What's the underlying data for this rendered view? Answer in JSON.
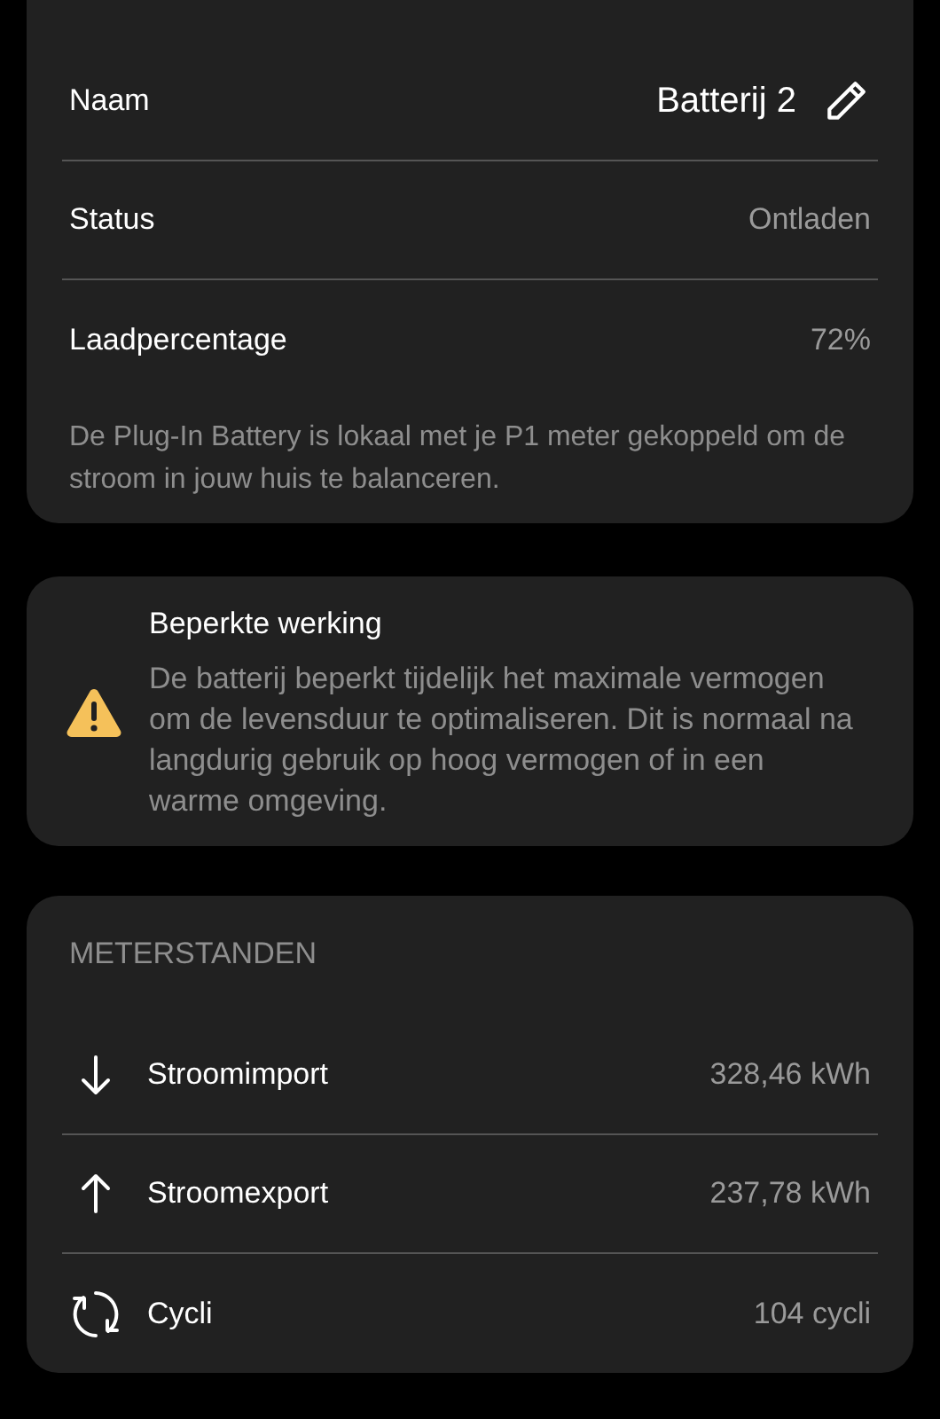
{
  "details": {
    "rows": [
      {
        "label": "Naam",
        "value": "Batterij 2",
        "editable": true
      },
      {
        "label": "Status",
        "value": "Ontladen",
        "editable": false
      },
      {
        "label": "Laadpercentage",
        "value": "72%",
        "editable": false
      }
    ],
    "description": "De Plug-In Battery is lokaal met je P1 meter gekoppeld om de stroom in jouw huis te balanceren."
  },
  "warning": {
    "title": "Beperkte werking",
    "text": "De batterij beperkt tijdelijk het maximale vermogen om de levensduur te optimaliseren. Dit is normaal na langdurig gebruik op hoog vermogen of in een warme omgeving."
  },
  "meters": {
    "title": "METERSTANDEN",
    "rows": [
      {
        "kind": "import",
        "label": "Stroomimport",
        "value": "328,46 kWh"
      },
      {
        "kind": "export",
        "label": "Stroomexport",
        "value": "237,78 kWh"
      },
      {
        "kind": "cycles",
        "label": "Cycli",
        "value": "104 cycli"
      }
    ]
  }
}
